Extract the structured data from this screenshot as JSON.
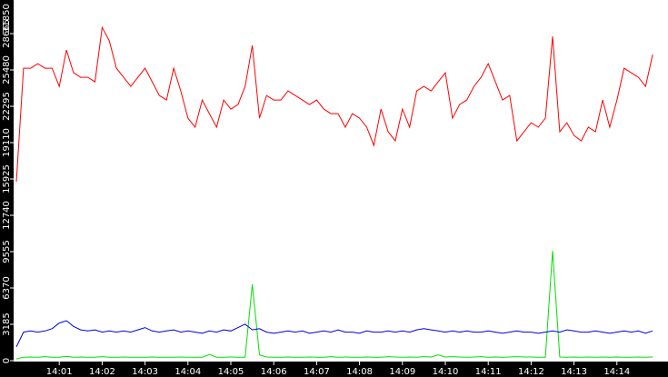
{
  "chart_data": {
    "type": "line",
    "title": "",
    "xlabel": "",
    "ylabel": "",
    "ylim": [
      0,
      31850
    ],
    "grid": false,
    "legend": "none",
    "x_start": "14:00:00",
    "interval_s": 10,
    "y_ticks": [
      0,
      3185,
      6370,
      9555,
      12740,
      15925,
      19110,
      22295,
      25480,
      28665,
      31850
    ],
    "x_ticks": [
      "14:01",
      "14:02",
      "14:03",
      "14:04",
      "14:05",
      "14:06",
      "14:07",
      "14:08",
      "14:09",
      "14:10",
      "14:11",
      "14:12",
      "14:13",
      "14:14"
    ],
    "series": [
      {
        "name": "red",
        "color": "#ff0000",
        "values": [
          15680,
          25630,
          25630,
          26030,
          25630,
          25630,
          24040,
          27220,
          25230,
          24835,
          24835,
          24440,
          29210,
          28020,
          25630,
          24835,
          24040,
          24835,
          25630,
          24440,
          23240,
          22845,
          25630,
          23640,
          21250,
          20460,
          22845,
          21650,
          20460,
          22845,
          22050,
          22450,
          24040,
          27620,
          21250,
          23240,
          22845,
          22845,
          23640,
          23240,
          22845,
          22450,
          22845,
          22050,
          21650,
          21650,
          20460,
          21650,
          21250,
          20460,
          18865,
          22050,
          20060,
          19260,
          22050,
          20460,
          23640,
          24040,
          23640,
          24440,
          25230,
          21250,
          22450,
          22845,
          24040,
          24835,
          26030,
          24440,
          22845,
          23240,
          19260,
          20060,
          20855,
          20460,
          21250,
          28420,
          20060,
          20855,
          19740,
          19260,
          20460,
          20060,
          22845,
          20460,
          22845,
          25630,
          25230,
          24835,
          24040,
          26825
        ]
      },
      {
        "name": "blue",
        "color": "#0000e0",
        "values": [
          1200,
          2500,
          2600,
          2500,
          2600,
          2800,
          3300,
          3500,
          3000,
          2700,
          2600,
          2700,
          2500,
          2600,
          2500,
          2600,
          2500,
          2700,
          2900,
          2600,
          2500,
          2600,
          2700,
          2500,
          2600,
          2500,
          2400,
          2600,
          2500,
          2700,
          2600,
          2900,
          3200,
          2700,
          2800,
          2500,
          2400,
          2500,
          2600,
          2500,
          2600,
          2400,
          2500,
          2600,
          2500,
          2700,
          2500,
          2500,
          2400,
          2600,
          2500,
          2500,
          2600,
          2500,
          2600,
          2500,
          2700,
          2800,
          2700,
          2600,
          2500,
          2600,
          2500,
          2600,
          2500,
          2500,
          2600,
          2500,
          2400,
          2500,
          2600,
          2500,
          2500,
          2400,
          2500,
          2600,
          2500,
          2700,
          2600,
          2500,
          2500,
          2600,
          2500,
          2400,
          2500,
          2600,
          2500,
          2600,
          2400,
          2600
        ]
      },
      {
        "name": "green",
        "color": "#00e000",
        "values": [
          150,
          300,
          320,
          300,
          350,
          300,
          300,
          380,
          300,
          320,
          300,
          300,
          350,
          300,
          300,
          320,
          300,
          300,
          300,
          320,
          300,
          300,
          300,
          320,
          300,
          300,
          300,
          550,
          300,
          300,
          320,
          300,
          300,
          6690,
          500,
          320,
          300,
          300,
          320,
          300,
          300,
          320,
          300,
          300,
          350,
          300,
          320,
          300,
          300,
          320,
          300,
          300,
          350,
          320,
          300,
          320,
          300,
          350,
          320,
          500,
          320,
          350,
          320,
          300,
          320,
          350,
          300,
          320,
          300,
          320,
          350,
          320,
          320,
          300,
          300,
          9630,
          320,
          300,
          320,
          300,
          320,
          300,
          320,
          300,
          320,
          300,
          300,
          320,
          300,
          320
        ]
      }
    ]
  }
}
